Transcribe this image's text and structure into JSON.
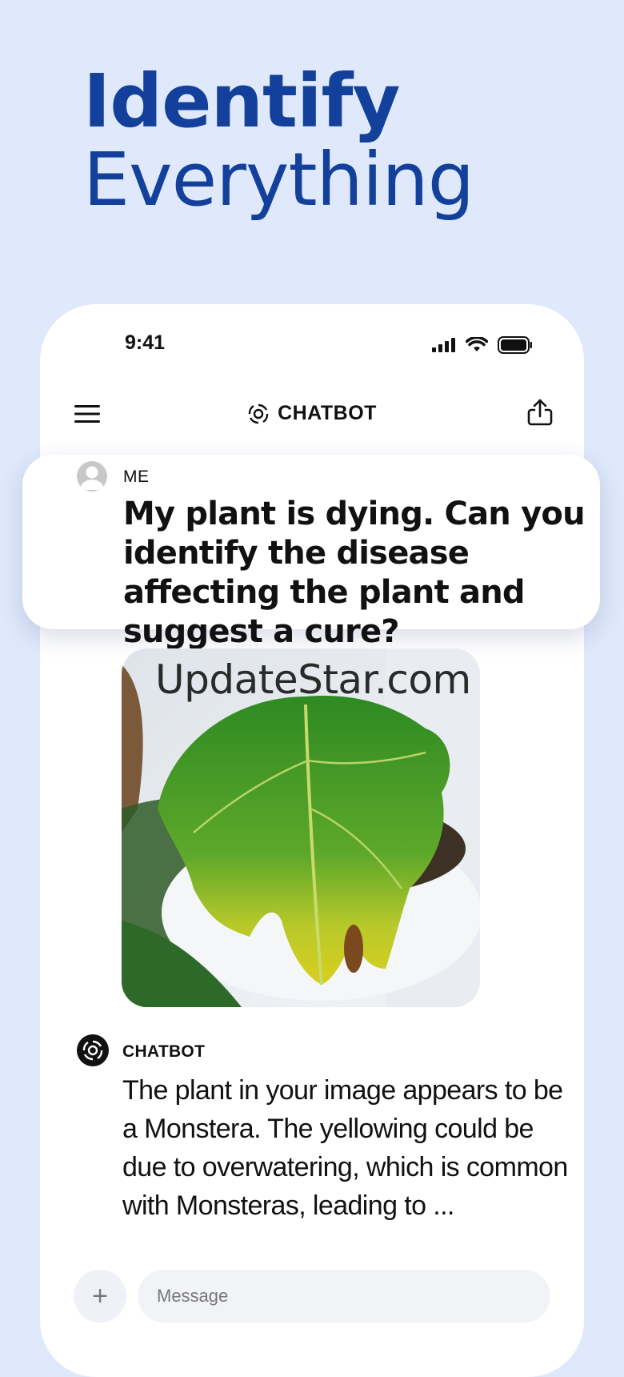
{
  "headline": {
    "line1": "Identify",
    "line2": "Everything"
  },
  "status_bar": {
    "time": "9:41",
    "icons": [
      "signal-icon",
      "wifi-icon",
      "battery-icon"
    ]
  },
  "app_bar": {
    "title": "CHATBOT",
    "left_icon": "menu-icon",
    "right_icon": "share-icon",
    "logo_icon": "chatbot-logo-icon"
  },
  "user_message": {
    "sender": "ME",
    "text": "My plant is dying. Can you identify the disease affecting the plant and suggest a cure?"
  },
  "watermark": "UpdateStar.com",
  "bot_message": {
    "sender": "CHATBOT",
    "text": "The plant in your image appears to be a Monstera. The yellowing could be due to overwatering, which is common with Monsteras, leading to ..."
  },
  "composer": {
    "plus": "+",
    "placeholder": "Message"
  },
  "colors": {
    "background": "#dfe9fb",
    "headline": "#12409a",
    "card": "#ffffff"
  }
}
